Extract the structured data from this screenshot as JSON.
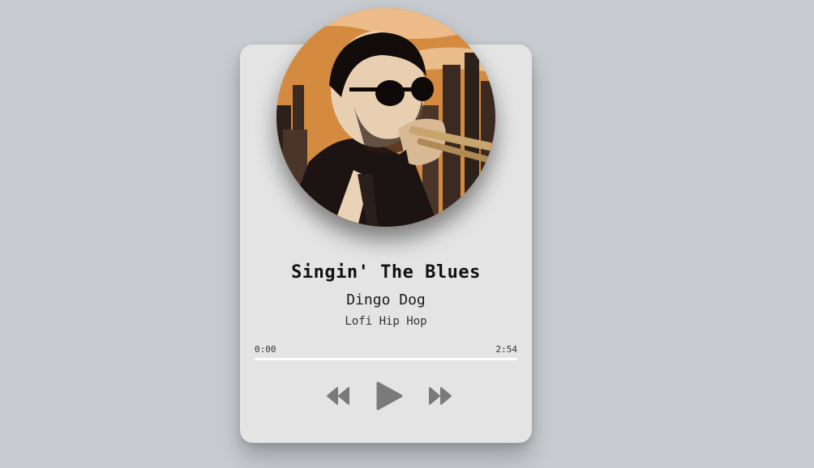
{
  "track": {
    "title": "Singin' The Blues",
    "artist": "Dingo Dog",
    "genre": "Lofi Hip Hop"
  },
  "playback": {
    "current_time": "0:00",
    "duration": "2:54",
    "progress": 0
  },
  "controls": {
    "previous_icon": "rewind-icon",
    "play_icon": "play-icon",
    "next_icon": "fast-forward-icon"
  },
  "colors": {
    "background": "#c8ccd0",
    "card": "#e4e4e4",
    "control": "#7a7a7a",
    "progress_track": "#ffffff",
    "cover_accent": "#d48a3f"
  }
}
